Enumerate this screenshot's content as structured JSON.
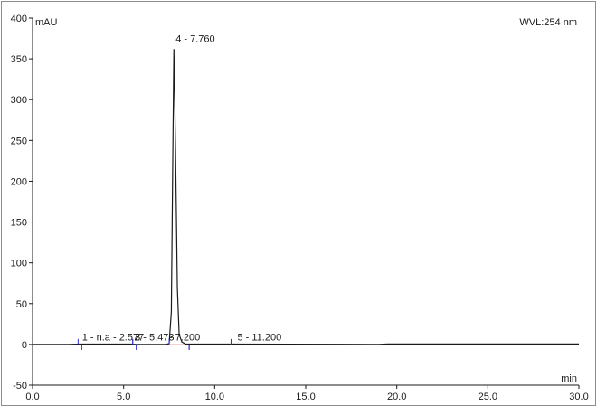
{
  "chart_data": {
    "type": "line",
    "title": "",
    "ylabel": "mAU",
    "xlabel": "min",
    "annotation": "WVL:254 nm",
    "xlim": [
      0,
      30
    ],
    "ylim": [
      -50,
      400
    ],
    "xticks": [
      0,
      5,
      10,
      15,
      20,
      25,
      30
    ],
    "xtick_labels": [
      "0.0",
      "5.0",
      "10.0",
      "15.0",
      "20.0",
      "25.0",
      "30.0"
    ],
    "yticks": [
      -50,
      0,
      50,
      100,
      150,
      200,
      250,
      300,
      350,
      400
    ],
    "ytick_labels": [
      "-50",
      "0",
      "50",
      "100",
      "150",
      "200",
      "250",
      "300",
      "350",
      "400"
    ],
    "grid": false,
    "colors": {
      "trace": "#1a1a1a",
      "baseline": "#d03030",
      "marker": "#2a2ad0",
      "frame": "#8c8c8c"
    },
    "series": [
      {
        "x": [
          0.0,
          2.0,
          2.6,
          5.4,
          5.7,
          7.3,
          7.5,
          7.62,
          7.7,
          7.76,
          7.85,
          7.95,
          8.05,
          8.2,
          8.4,
          11.2,
          19.0,
          19.5,
          30.0
        ],
        "values": [
          0,
          0,
          0.5,
          0.5,
          0,
          0,
          1,
          40,
          230,
          362,
          240,
          70,
          12,
          3,
          0.5,
          0.5,
          0,
          0.6,
          0.6
        ]
      }
    ],
    "peaks": [
      {
        "label": "1 - n.a - 2.577",
        "rt": 2.57,
        "height": 0.5,
        "start": 2.5,
        "end": 2.7
      },
      {
        "label": "2",
        "rt": 5.5,
        "height": 0.5,
        "start": 5.5,
        "end": 5.7
      },
      {
        "label": "3 - 5.473",
        "rt": 5.47,
        "height": 0.5,
        "start": 5.5,
        "end": 5.7
      },
      {
        "label": "4 - 7.760",
        "rt": 7.76,
        "height": 362,
        "start": 7.5,
        "end": 8.6
      },
      {
        "label": "- 7.200",
        "rt": 7.2,
        "height": 0.5,
        "start": 7.5,
        "end": 8.6
      },
      {
        "label": "5 - 11.200",
        "rt": 11.2,
        "height": 0.5,
        "start": 10.9,
        "end": 11.5
      }
    ]
  }
}
